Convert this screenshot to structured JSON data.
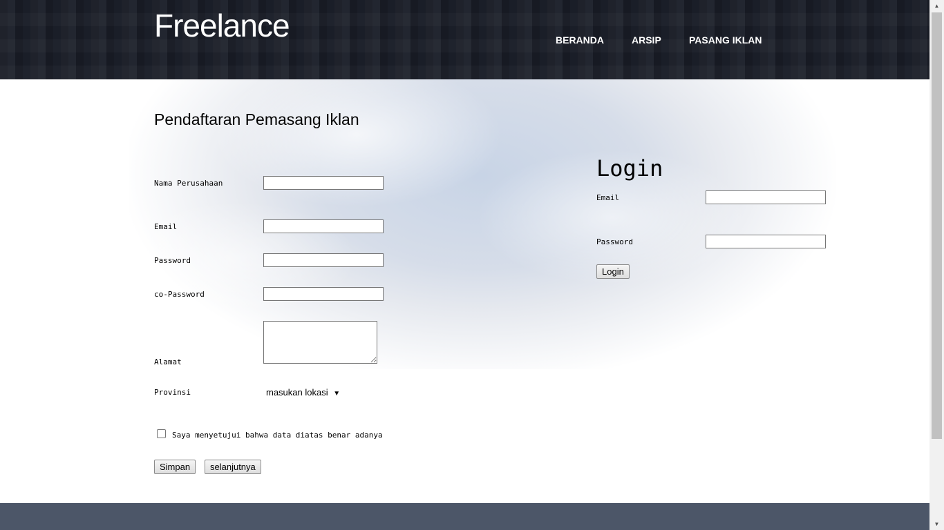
{
  "header": {
    "logo": "Freelance",
    "nav": [
      "BERANDA",
      "ARSIP",
      "PASANG IKLAN"
    ]
  },
  "register": {
    "title": "Pendaftaran Pemasang Iklan",
    "company_label": "Nama Perusahaan",
    "company_value": "",
    "email_label": "Email",
    "email_value": "",
    "password_label": "Password",
    "password_value": "",
    "copassword_label": "co-Password",
    "copassword_value": "",
    "address_label": "Alamat",
    "address_value": "",
    "province_label": "Provinsi",
    "province_selected": "masukan lokasi",
    "agree_text": "Saya menyetujui bahwa data diatas benar adanya",
    "agree_checked": false,
    "save_button": "Simpan",
    "next_button": "selanjutnya"
  },
  "login": {
    "title": "Login",
    "email_label": "Email",
    "email_value": "",
    "password_label": "Password",
    "password_value": "",
    "login_button": "Login"
  },
  "icons": {
    "select_arrow": "dropdown-arrow-icon",
    "scroll_up": "scroll-up-arrow-icon",
    "scroll_down": "scroll-down-arrow-icon"
  },
  "colors": {
    "header_bg": "#1a1e28",
    "footer_bg": "#4c5668"
  }
}
